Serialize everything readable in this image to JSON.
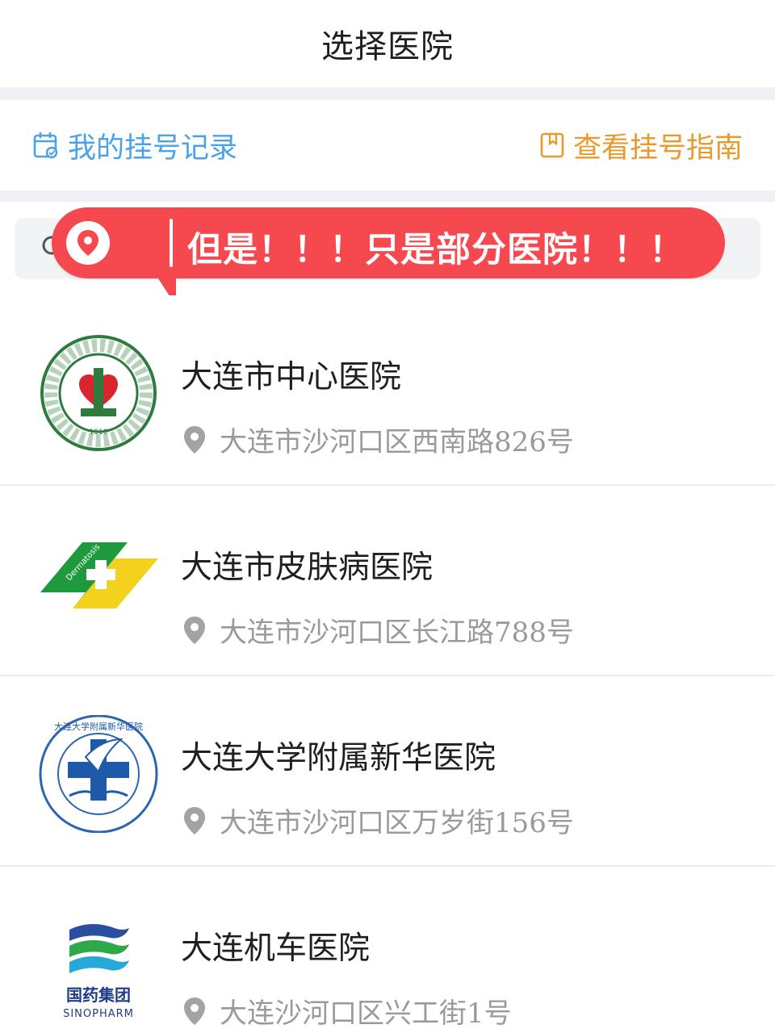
{
  "header": {
    "title": "选择医院"
  },
  "actions": {
    "records_label": "我的挂号记录",
    "guide_label": "查看挂号指南",
    "records_color": "#4aa2e8",
    "guide_color": "#e89a2b"
  },
  "search": {
    "placeholder": ""
  },
  "banner": {
    "text": "但是！！！只是部分医院！！！",
    "color": "#f5484f"
  },
  "hospitals": [
    {
      "name": "大连市中心医院",
      "address": "大连市沙河口区西南路826号",
      "logo": "dalian-central-hospital-logo",
      "logo_text": "1910"
    },
    {
      "name": "大连市皮肤病医院",
      "address": "大连市沙河口区长江路788号",
      "logo": "dermatosis-hospital-logo",
      "logo_text": "Dermatosis"
    },
    {
      "name": "大连大学附属新华医院",
      "address": "大连市沙河口区万岁街156号",
      "logo": "xinhua-hospital-logo",
      "logo_text": "大连大学附属新华医院"
    },
    {
      "name": "大连机车医院",
      "address": "大连沙河口区兴工街1号",
      "logo": "sinopharm-logo",
      "logo_text": "国药集团",
      "logo_text_en": "SINOPHARM"
    }
  ]
}
